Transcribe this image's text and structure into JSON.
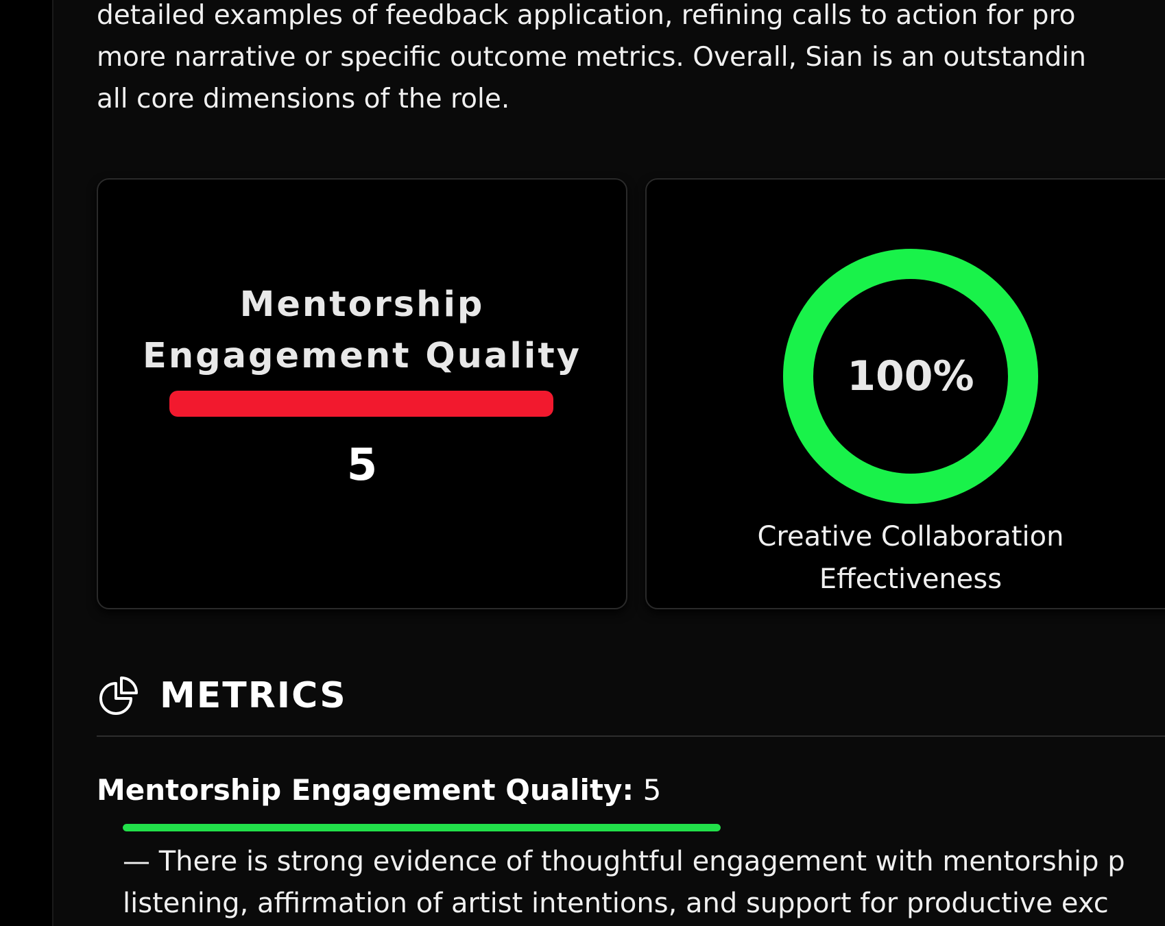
{
  "summary": {
    "lines": [
      "detailed examples of feedback application, refining calls to action for pro",
      "more narrative or specific outcome metrics. Overall, Sian is an outstandin",
      "all core dimensions of the role."
    ]
  },
  "cards": {
    "mentorship": {
      "title_line1": "Mentorship",
      "title_line2": "Engagement Quality",
      "value": "5",
      "bar_fraction": 1.0,
      "bar_color": "#f2192e"
    },
    "collaboration": {
      "percent_label": "100%",
      "percent": 100,
      "ring_color": "#19f24a",
      "caption_line1": "Creative Collaboration",
      "caption_line2": "Effectiveness"
    }
  },
  "metrics_section": {
    "icon": "pie-chart-icon",
    "title": "METRICS",
    "item": {
      "name": "Mentorship Engagement Quality:",
      "score": "5",
      "bar_fraction": 1.0,
      "bar_color": "#22e04a",
      "desc_lines": [
        "— There is strong evidence of thoughtful engagement with mentorship p",
        "listening, affirmation of artist intentions, and support for productive exc"
      ]
    }
  }
}
